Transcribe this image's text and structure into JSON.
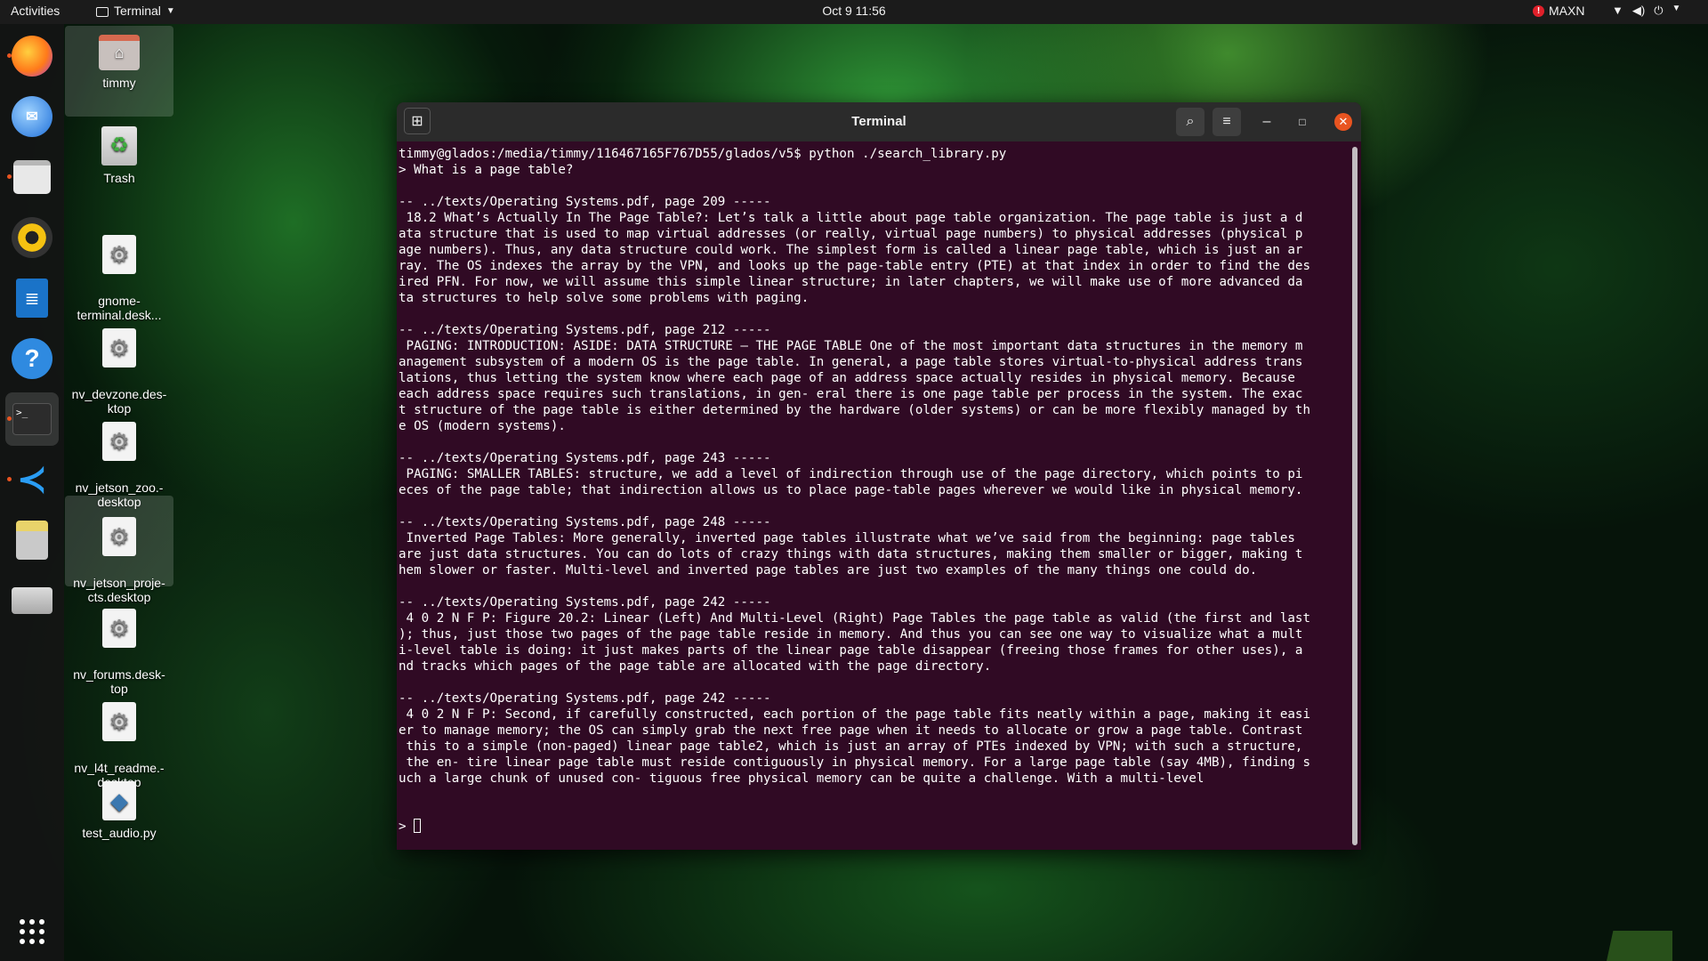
{
  "topbar": {
    "activities": "Activities",
    "app_name": "Terminal",
    "clock": "Oct 9  11:56",
    "power_mode": "MAXN"
  },
  "dock": {
    "items": [
      "firefox",
      "thunderbird",
      "files",
      "rhythmbox",
      "libreoffice-writer",
      "help",
      "terminal",
      "vscode",
      "sd-card",
      "drive",
      "show-applications"
    ]
  },
  "desktop": {
    "icons": [
      {
        "label": "timmy"
      },
      {
        "label": "Trash"
      },
      {
        "label": "gnome-\nterminal.desk..."
      },
      {
        "label": "nv_devzone.des-\nktop"
      },
      {
        "label": "nv_jetson_zoo.-\ndesktop"
      },
      {
        "label": "nv_jetson_proje-\ncts.desktop"
      },
      {
        "label": "nv_forums.desk-\ntop"
      },
      {
        "label": "nv_l4t_readme.-\ndesktop"
      },
      {
        "label": "test_audio.py"
      }
    ]
  },
  "terminal": {
    "title": "Terminal",
    "lines": [
      "timmy@glados:/media/timmy/116467165F767D55/glados/v5$ python ./search_library.py",
      "> What is a page table?",
      "",
      "-- ../texts/Operating Systems.pdf, page 209 -----",
      " 18.2 What’s Actually In The Page Table?: Let’s talk a little about page table organization. The page table is just a d",
      "ata structure that is used to map virtual addresses (or really, virtual page numbers) to physical addresses (physical p",
      "age numbers). Thus, any data structure could work. The simplest form is called a linear page table, which is just an ar",
      "ray. The OS indexes the array by the VPN, and looks up the page-table entry (PTE) at that index in order to find the des",
      "ired PFN. For now, we will assume this simple linear structure; in later chapters, we will make use of more advanced da",
      "ta structures to help solve some problems with paging.",
      "",
      "-- ../texts/Operating Systems.pdf, page 212 -----",
      " PAGING: INTRODUCTION: ASIDE: DATA STRUCTURE — THE PAGE TABLE One of the most important data structures in the memory m",
      "anagement subsystem of a modern OS is the page table. In general, a page table stores virtual-to-physical address trans",
      "lations, thus letting the system know where each page of an address space actually resides in physical memory. Because",
      "each address space requires such translations, in gen- eral there is one page table per process in the system. The exac",
      "t structure of the page table is either determined by the hardware (older systems) or can be more flexibly managed by th",
      "e OS (modern systems).",
      "",
      "-- ../texts/Operating Systems.pdf, page 243 -----",
      " PAGING: SMALLER TABLES: structure, we add a level of indirection through use of the page directory, which points to pi",
      "eces of the page table; that indirection allows us to place page-table pages wherever we would like in physical memory.",
      "",
      "-- ../texts/Operating Systems.pdf, page 248 -----",
      " Inverted Page Tables: More generally, inverted page tables illustrate what we’ve said from the beginning: page tables",
      "are just data structures. You can do lots of crazy things with data structures, making them smaller or bigger, making t",
      "hem slower or faster. Multi-level and inverted page tables are just two examples of the many things one could do.",
      "",
      "-- ../texts/Operating Systems.pdf, page 242 -----",
      " 4 0 2 N F P: Figure 20.2: Linear (Left) And Multi-Level (Right) Page Tables the page table as valid (the first and last",
      "); thus, just those two pages of the page table reside in memory. And thus you can see one way to visualize what a mult",
      "i-level table is doing: it just makes parts of the linear page table disappear (freeing those frames for other uses), a",
      "nd tracks which pages of the page table are allocated with the page directory.",
      "",
      "-- ../texts/Operating Systems.pdf, page 242 -----",
      " 4 0 2 N F P: Second, if carefully constructed, each portion of the page table fits neatly within a page, making it easi",
      "er to manage memory; the OS can simply grab the next free page when it needs to allocate or grow a page table. Contrast",
      " this to a simple (non-paged) linear page table2, which is just an array of PTEs indexed by VPN; with such a structure,",
      " the en- tire linear page table must reside contiguously in physical memory. For a large page table (say 4MB), finding s",
      "uch a large chunk of unused con- tiguous free physical memory can be quite a challenge. With a multi-level",
      "",
      ""
    ],
    "prompt": "> "
  }
}
